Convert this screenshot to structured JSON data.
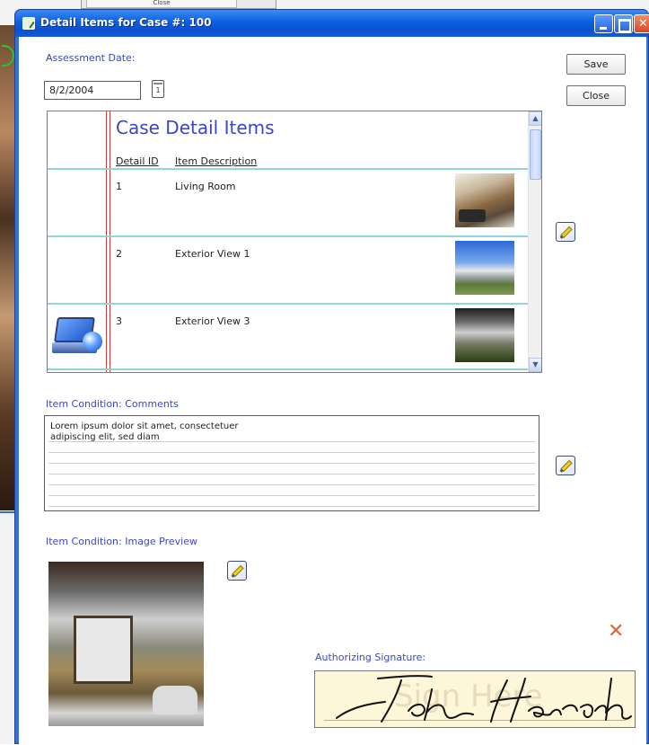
{
  "background": {
    "top_button_label": "Close"
  },
  "window": {
    "title": "Detail Items for Case #: 100",
    "controls": {
      "minimize": "",
      "maximize": "",
      "close": "✕"
    }
  },
  "assessment": {
    "label": "Assessment Date:",
    "value": "8/2/2004",
    "calendar_icon": "calendar-icon",
    "calendar_glyph": "1"
  },
  "toolbar": {
    "save_label": "Save",
    "close_label": "Close"
  },
  "detail_list": {
    "title": "Case Detail Items",
    "columns": [
      "Detail ID",
      "Item Description"
    ],
    "items": [
      {
        "id": "1",
        "description": "Living Room",
        "image": "living-room-photo"
      },
      {
        "id": "2",
        "description": "Exterior View 1",
        "image": "exterior-view-photo"
      },
      {
        "id": "3",
        "description": "Exterior View 3",
        "image": "exterior-view-photo"
      }
    ],
    "scroll_up": "▲",
    "scroll_down": "▼"
  },
  "comments": {
    "label": "Item Condition: Comments",
    "text": "Lorem ipsum dolor sit amet, consectetuer\nadipiscing elit, sed diam"
  },
  "preview": {
    "label": "Item Condition: Image Preview"
  },
  "signature": {
    "label": "Authorizing Signature:",
    "clear_glyph": "✕",
    "hint": "Sign Here",
    "signer": "John Hancock"
  },
  "colors": {
    "title_bar": "#0c5fe0",
    "label_blue": "#3a46c8",
    "row_separator": "#8fd6d6",
    "margin_red": "#d43b3b",
    "signature_pad": "#fdf6d8",
    "clear_x": "#e0623a"
  }
}
